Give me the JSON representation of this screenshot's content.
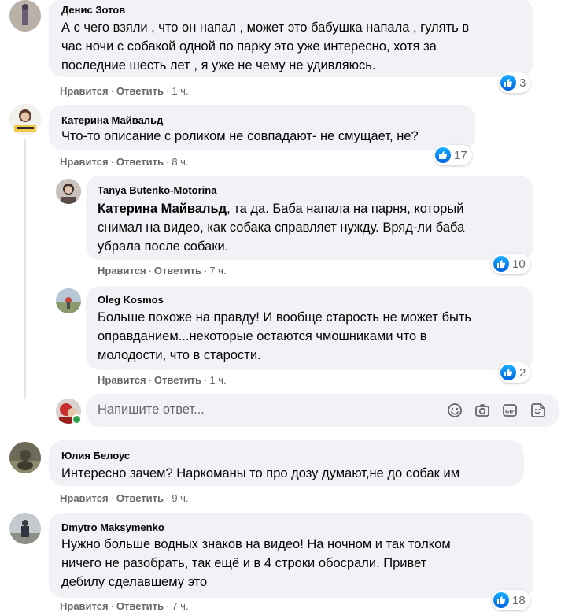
{
  "colors": {
    "bubble": "#f0f2f5",
    "text": "#050505",
    "meta": "#65676b",
    "like_gradient_top": "#18afff",
    "like_gradient_bottom": "#0062df",
    "online": "#31a24c"
  },
  "actions": {
    "like": "Нравится",
    "reply": "Ответить",
    "separator": "·"
  },
  "comments": [
    {
      "author": "Денис Зотов",
      "lines": [
        "А с чего взяли , что он напал , может это бабушка напала , гулять в",
        "час ночи с собакой одной по парку это уже интересно, хотя за",
        "последние шесть лет , я уже не чему не удивляюсь."
      ],
      "time": "1 ч.",
      "reactions": "3"
    },
    {
      "author": "Катерина Майвальд",
      "lines": [
        "Что-то описание с роликом не совпадают- не смущает, не?"
      ],
      "time": "8 ч.",
      "reactions": "17"
    },
    {
      "author": "Tanya Butenko-Motorina",
      "mention": "Катерина Майвальд",
      "first_line_rest": ", та да. Баба напала на парня, который",
      "lines": [
        "снимал на видео, как собака справляет нужду. Вряд-ли баба",
        "убрала после собаки."
      ],
      "time": "7 ч.",
      "reactions": "10"
    },
    {
      "author": "Oleg Kosmos",
      "lines": [
        "Больше похоже на правду! И вообще старость не может быть",
        "оправданием...некоторые остаются чмошниками что в",
        "молодости, что в старости."
      ],
      "time": "1 ч.",
      "reactions": "2"
    },
    {
      "author": "Юлия Белоус",
      "lines": [
        "Интересно зачем? Наркоманы то про дозу думают,не до собак им"
      ],
      "time": "9 ч."
    },
    {
      "author": "Dmytro Maksymenko",
      "lines": [
        "Нужно больше водных знаков на видео! На ночном и так толком",
        "ничего не разобрать, так ещё и в 4 строки обосрали. Привет",
        "дебилу сделавшему это"
      ],
      "time": "7 ч.",
      "reactions": "18"
    }
  ],
  "reply_box": {
    "placeholder": "Напишите ответ...",
    "icons": [
      "emoji-icon",
      "camera-icon",
      "gif-icon",
      "sticker-icon"
    ]
  }
}
